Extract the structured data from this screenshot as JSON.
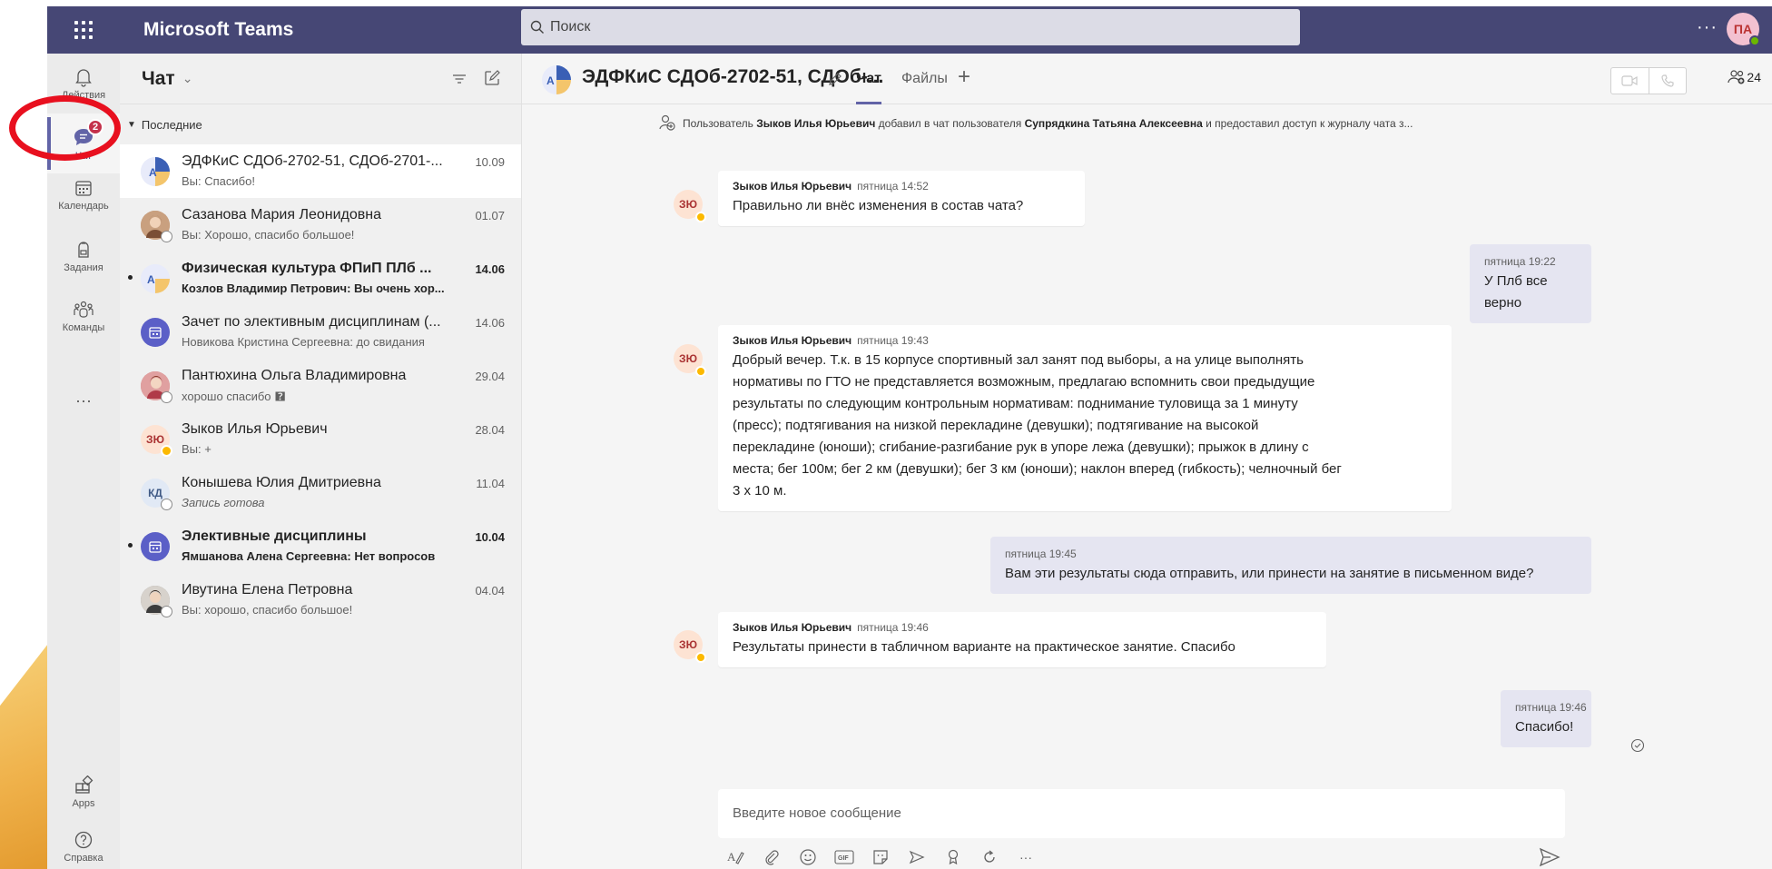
{
  "topbar": {
    "app_title": "Microsoft Teams",
    "search_placeholder": "Поиск",
    "more": "···",
    "user_initials": "ПА"
  },
  "rail": {
    "items": [
      {
        "label": "Действия",
        "icon": "bell-icon"
      },
      {
        "label": "Чат",
        "icon": "chat-icon",
        "badge": "2"
      },
      {
        "label": "Календарь",
        "icon": "calendar-icon"
      },
      {
        "label": "Задания",
        "icon": "assignments-icon"
      },
      {
        "label": "Команды",
        "icon": "teams-icon"
      }
    ],
    "more": "···",
    "apps_label": "Apps",
    "help_label": "Справка"
  },
  "chatlist": {
    "title": "Чат",
    "section": "Последние",
    "items": [
      {
        "name": "ЭДФКиС СДОб-2702-51, СДОб-2701-...",
        "preview": "Вы: Спасибо!",
        "date": "10.09",
        "avatar": "A",
        "selected": true,
        "unread": false
      },
      {
        "name": "Сазанова Мария Леонидовна",
        "preview": "Вы: Хорошо, спасибо большое!",
        "date": "01.07",
        "avatar": "",
        "unread": false
      },
      {
        "name": "Физическая культура ФПиП ПЛб ...",
        "preview": "Козлов Владимир Петрович: Вы очень хор...",
        "date": "14.06",
        "avatar": "A",
        "unread": true
      },
      {
        "name": "Зачет по элективным дисциплинам (...",
        "preview": "Новикова Кристина Сергеевна: до свидания",
        "date": "14.06",
        "avatar": "",
        "unread": false
      },
      {
        "name": "Пантюхина Ольга Владимировна",
        "preview": "хорошо спасибо 🯄",
        "date": "29.04",
        "avatar": "",
        "unread": false
      },
      {
        "name": "Зыков Илья Юрьевич",
        "preview": "Вы: +",
        "date": "28.04",
        "avatar": "ЗЮ",
        "unread": false
      },
      {
        "name": "Конышева Юлия Дмитриевна",
        "preview": "Запись готова",
        "date": "11.04",
        "avatar": "КД",
        "unread": false
      },
      {
        "name": "Элективные дисциплины",
        "preview": "Ямшанова Алена Сергеевна: Нет вопросов",
        "date": "10.04",
        "avatar": "",
        "unread": true
      },
      {
        "name": "Ивутина Елена Петровна",
        "preview": "Вы: хорошо, спасибо большое!",
        "date": "04.04",
        "avatar": "",
        "unread": false
      }
    ]
  },
  "main": {
    "title": "ЭДФКиС СДОб-2702-51, СДОб-...",
    "tabs": {
      "chat": "Чат",
      "files": "Файлы",
      "add": "+"
    },
    "participants_count": "24",
    "system_message": {
      "prefix": "Пользователь",
      "actor": "Зыков Илья Юрьевич",
      "middle": "добавил в чат пользователя",
      "target": "Супрядкина Татьяна Алексеевна",
      "suffix": "и предоставил доступ к журналу чата з..."
    },
    "messages": [
      {
        "author": "Зыков Илья Юрьевич",
        "time": "пятница 14:52",
        "text": "Правильно ли внёс изменения в состав чата?",
        "initials": "ЗЮ"
      },
      {
        "time": "пятница 19:22",
        "text": "У Плб все верно"
      },
      {
        "author": "Зыков Илья Юрьевич",
        "time": "пятница 19:43",
        "initials": "ЗЮ",
        "lines": [
          "Добрый вечер. Т.к. в 15 корпусе спортивный зал занят под выборы, а на улице выполнять",
          "нормативы по ГТО не представляется возможным, предлагаю вспомнить свои предыдущие",
          "результаты по следующим контрольным нормативам: поднимание туловища за 1 минуту",
          "(пресс); подтягивания на низкой перекладине (девушки); подтягивание на высокой",
          "перекладине (юноши); сгибание-разгибание рук в упоре лежа (девушки); прыжок в длину с",
          "места; бег 100м; бег 2 км (девушки); бег 3 км (юноши); наклон вперед (гибкость); челночный бег",
          "3 х 10 м."
        ]
      },
      {
        "time": "пятница 19:45",
        "text": "Вам эти результаты сюда отправить, или принести на занятие в письменном виде?"
      },
      {
        "author": "Зыков Илья Юрьевич",
        "time": "пятница 19:46",
        "text": "Результаты принести в табличном варианте на практическое занятие. Спасибо",
        "initials": "ЗЮ"
      },
      {
        "time": "пятница 19:46",
        "text": "Спасибо!"
      }
    ],
    "compose_placeholder": "Введите новое сообщение",
    "toolbar_icons": [
      "format-icon",
      "attach-icon",
      "emoji-icon",
      "gif-icon",
      "sticker-icon",
      "meet-now-icon",
      "praise-icon",
      "loop-icon",
      "more-options-icon"
    ],
    "toolbar_gif": "GIF",
    "toolbar_more": "···"
  },
  "colors": {
    "brand": "#464775",
    "accent": "#6264a7",
    "badge": "#c4314b",
    "highlight_ring": "#e8101f"
  }
}
